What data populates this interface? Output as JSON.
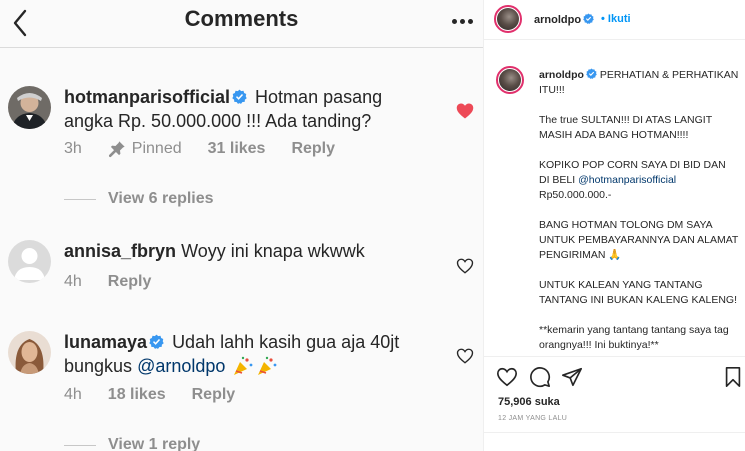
{
  "header": {
    "title": "Comments"
  },
  "comments": [
    {
      "username": "hotmanparisofficial",
      "text": "Hotman pasang angka Rp. 50.000.000 !!! Ada tanding?",
      "time": "3h",
      "pinned": "Pinned",
      "likes": "31 likes",
      "reply": "Reply",
      "liked": true,
      "liked_color": "#ed4956",
      "view_replies": "View 6 replies"
    },
    {
      "username": "annisa_fbryn",
      "text": "Woyy ini knapa wkwwk",
      "time": "4h",
      "reply": "Reply"
    },
    {
      "username": "lunamaya",
      "text_before": "Udah lahh kasih gua aja 40jt bungkus",
      "mention": "@arnoldpo",
      "emoji": "party-popper-icons",
      "time": "4h",
      "likes": "18 likes",
      "reply": "Reply",
      "view_replies": "View 1 reply"
    }
  ],
  "post": {
    "username": "arnoldpo",
    "follow_label": "Ikuti",
    "caption_lead": "PERHATIAN & PERHATIKAN ITU!!!",
    "caption_paragraphs": [
      "The true SULTAN!!! DI ATAS LANGIT MASIH ADA BANG HOTMAN!!!!",
      "KOPIKO POP CORN SAYA DI BID DAN DI BELI",
      "BANG HOTMAN TOLONG DM SAYA UNTUK PEMBAYARANNYA DAN ALAMAT PENGIRIMAN 🙏",
      "UNTUK KALEAN YANG TANTANG TANTANG INI BUKAN KALENG KALENG!",
      "**kemarin yang tantang tantang saya tag orangnya!!! Ini buktinya!**"
    ],
    "caption_mention": "@hotmanparisofficial",
    "caption_amount": "Rp50.000.000.-",
    "likes": "75,906 suka",
    "time": "12 JAM YANG LALU"
  },
  "colors": {
    "verified": "#3897f0",
    "link": "#00376b",
    "secondary_text": "#8e8e8e",
    "follow_blue": "#0095f6"
  }
}
